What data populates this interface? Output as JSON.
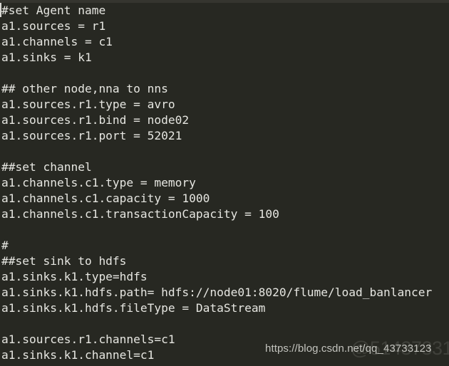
{
  "editor": {
    "background_color": "#272822",
    "text_color": "#e6e6e1",
    "caret_color": "#d7d7d2",
    "font_size_px": 16,
    "line_height_px": 22,
    "language": "properties",
    "lines": [
      "#set Agent name",
      "a1.sources = r1",
      "a1.channels = c1",
      "a1.sinks = k1",
      "",
      "## other node,nna to nns",
      "a1.sources.r1.type = avro",
      "a1.sources.r1.bind = node02",
      "a1.sources.r1.port = 52021",
      "",
      "##set channel",
      "a1.channels.c1.type = memory",
      "a1.channels.c1.capacity = 1000",
      "a1.channels.c1.transactionCapacity = 100",
      "",
      "#",
      "##set sink to hdfs",
      "a1.sinks.k1.type=hdfs",
      "a1.sinks.k1.hdfs.path= hdfs://node01:8020/flume/load_banlancer",
      "a1.sinks.k1.hdfs.fileType = DataStream",
      "",
      "a1.sources.r1.channels=c1",
      "a1.sinks.k1.channel=c1"
    ]
  },
  "watermark": {
    "url": "https://blog.csdn.net/qq_43733123",
    "ghost": "@5143733123"
  }
}
